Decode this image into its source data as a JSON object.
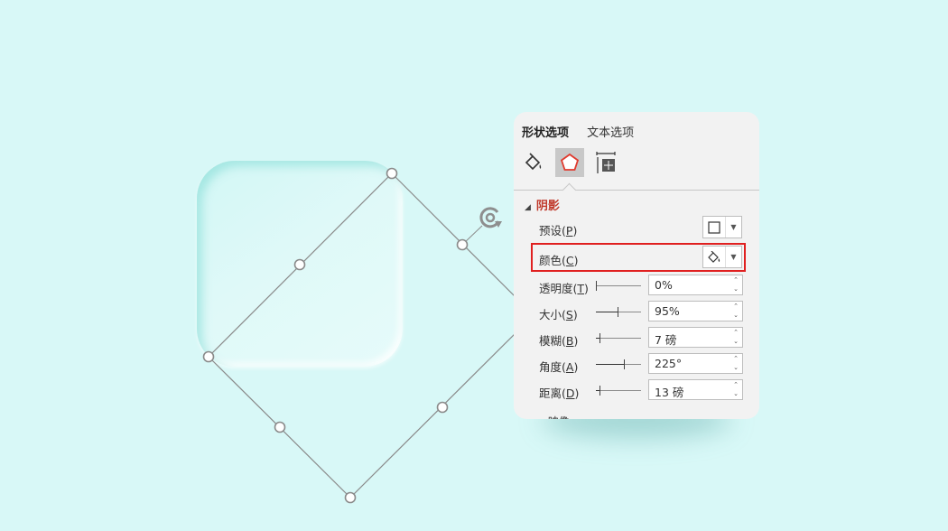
{
  "pane": {
    "tabs": [
      "形状选项",
      "文本选项"
    ],
    "categories": {
      "fill": "fill-line-icon",
      "effects": "effects-icon",
      "size": "size-properties-icon"
    },
    "section_title": "阴影",
    "rows": {
      "preset": {
        "label": "预设",
        "key": "P"
      },
      "color": {
        "label": "颜色",
        "key": "C"
      },
      "transparency": {
        "label": "透明度",
        "key": "T",
        "value": "0%",
        "level": 0
      },
      "size": {
        "label": "大小",
        "key": "S",
        "value": "95%",
        "level": 0.47
      },
      "blur": {
        "label": "模糊",
        "key": "B",
        "value": "7 磅",
        "level": 0.07
      },
      "angle": {
        "label": "角度",
        "key": "A",
        "value": "225°",
        "level": 0.62
      },
      "distance": {
        "label": "距离",
        "key": "D",
        "value": "13 磅",
        "level": 0.07
      }
    },
    "next_section_partial": "映像"
  },
  "colors": {
    "background": "#d8f8f7",
    "pane": "#f2f2f2",
    "section_title": "#c0392b",
    "highlight": "#e02020"
  }
}
